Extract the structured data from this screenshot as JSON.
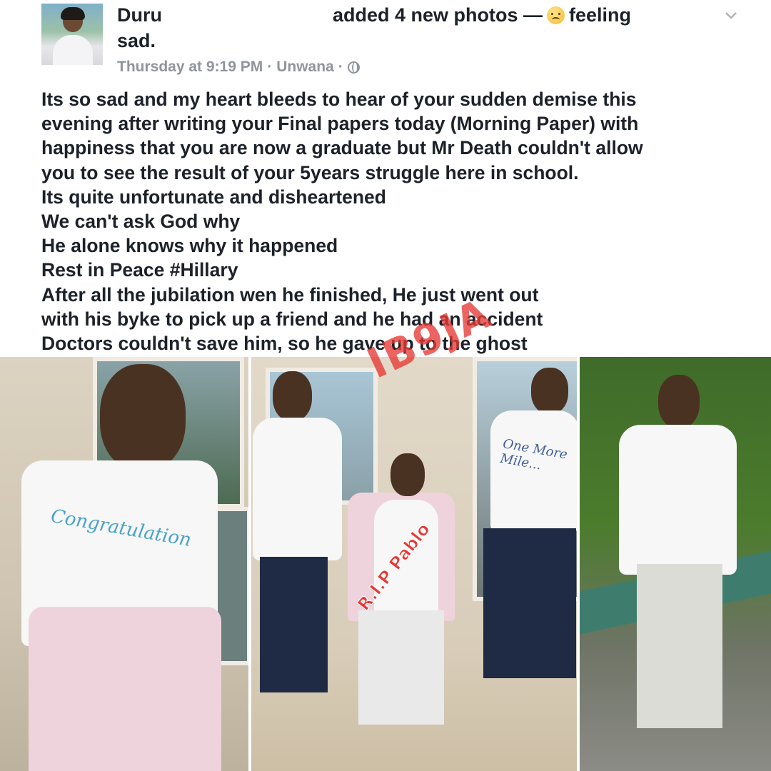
{
  "post": {
    "author_name": "Duru",
    "action_text": "added 4 new photos —",
    "feeling_emoji": "sad-face-emoji",
    "feeling_label": "feeling",
    "feeling_value": "sad.",
    "timestamp": "Thursday at 9:19 PM",
    "separator": "·",
    "location": "Unwana",
    "privacy_icon": "globe-icon",
    "body_lines": [
      "Its so sad and my heart bleeds to hear of your sudden demise this",
      "evening after writing your Final papers today (Morning Paper) with",
      "happiness that you are now a graduate but Mr Death couldn't allow",
      "you to see the result of your 5years struggle here in school.",
      "Its quite unfortunate and disheartened",
      "We can't ask God why",
      "He alone knows why it happened",
      "Rest in Peace #Hillary",
      "After all the jubilation wen he finished, He just went out",
      "with his byke to pick up a friend and he had an accident",
      "Doctors couldn't save him, so he gave up to the ghost"
    ]
  },
  "photos": {
    "shirt_texts": {
      "left": "Congratulation",
      "middle_right": "One More Mile..."
    },
    "watermark": "IB9JA",
    "caption_overlay": "R.I.P Pablo"
  },
  "colors": {
    "text_primary": "#1d2129",
    "text_meta": "#90949c",
    "watermark": "#e53935"
  }
}
